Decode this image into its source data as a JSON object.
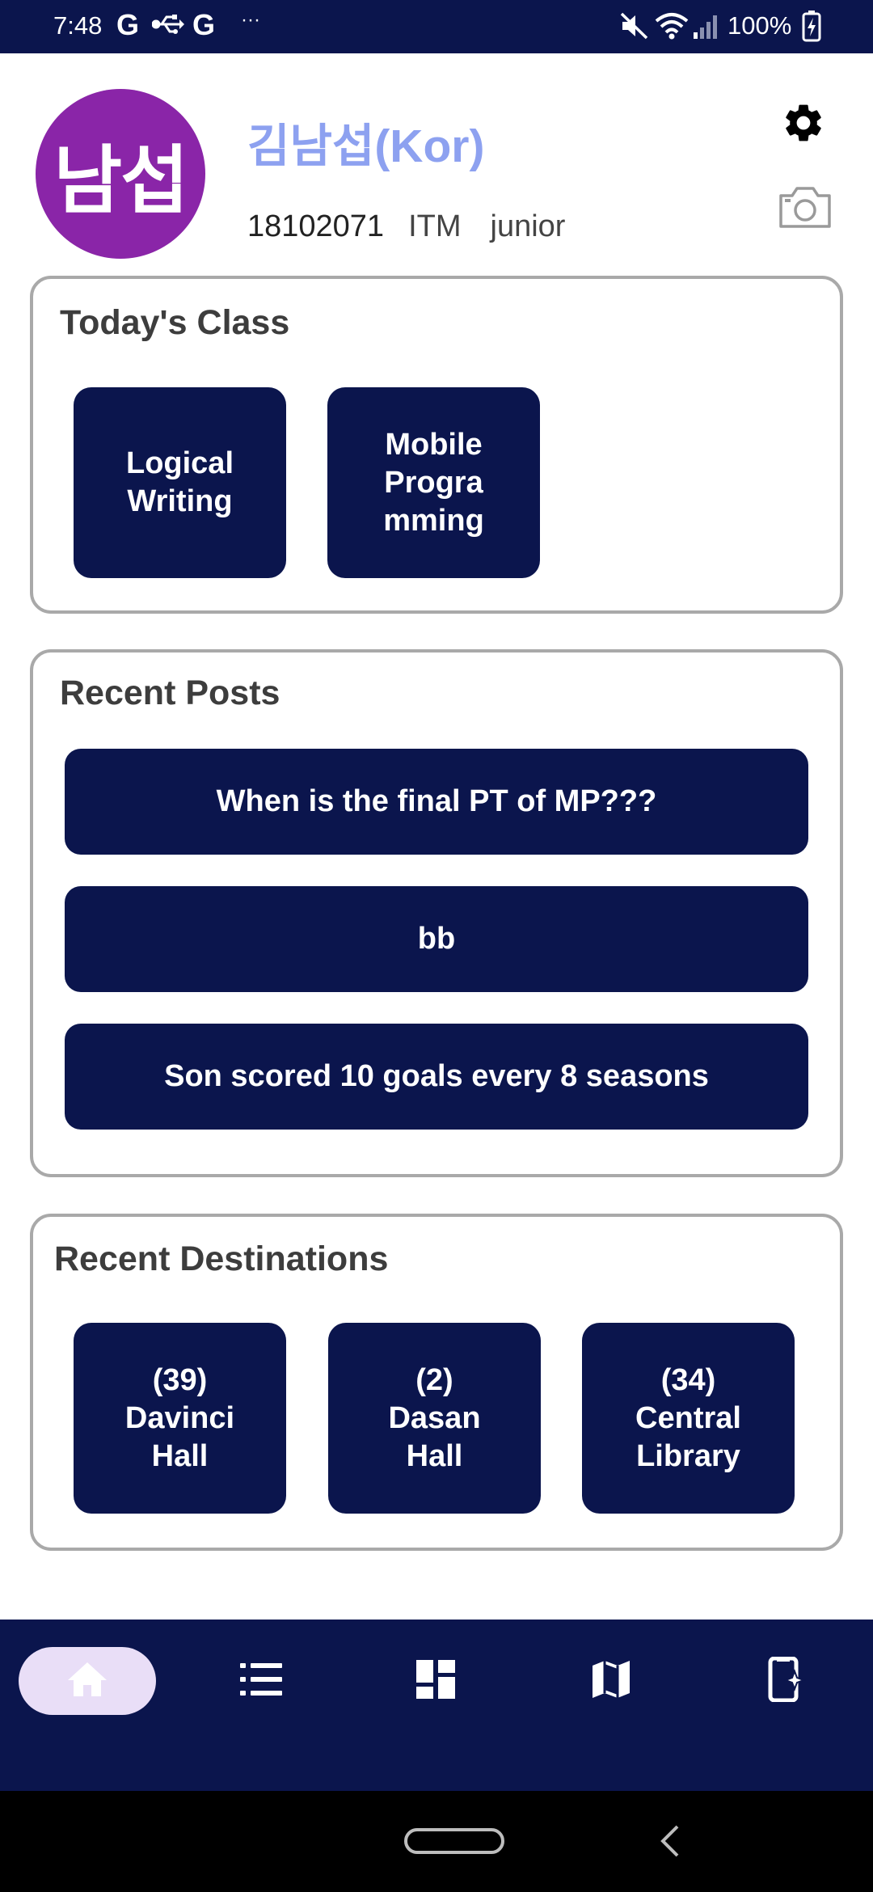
{
  "status_bar": {
    "time": "7:48",
    "g1": "G",
    "usb_icon": "usb-icon",
    "g2": "G",
    "dots": "···",
    "mute_icon": "mute-icon",
    "wifi_icon": "wifi-icon",
    "signal_icon": "signal-icon",
    "battery_text": "100%",
    "battery_icon": "battery-charging-icon"
  },
  "profile": {
    "avatar_text": "남섭",
    "avatar_color": "#8a25a8",
    "name": "김남섭(Kor)",
    "student_id": "18102071",
    "major": "ITM",
    "year": "junior",
    "settings_icon": "gear-icon",
    "camera_icon": "camera-icon"
  },
  "todays_class": {
    "title": "Today's Class",
    "classes": [
      {
        "label": "Logical\nWriting"
      },
      {
        "label": "Mobile\nProgra\nmming"
      }
    ]
  },
  "recent_posts": {
    "title": "Recent Posts",
    "posts": [
      {
        "label": "When is the final PT of MP???"
      },
      {
        "label": "bb"
      },
      {
        "label": "Son scored 10 goals every 8 seasons"
      }
    ]
  },
  "recent_destinations": {
    "title": "Recent Destinations",
    "destinations": [
      {
        "label": "(39)\nDavinci\nHall"
      },
      {
        "label": "(2)\nDasan\nHall"
      },
      {
        "label": "(34)\nCentral\nLibrary"
      }
    ]
  },
  "bottom_nav": {
    "items": [
      {
        "icon": "home-icon",
        "active": true
      },
      {
        "icon": "list-icon",
        "active": false
      },
      {
        "icon": "dashboard-icon",
        "active": false
      },
      {
        "icon": "map-icon",
        "active": false
      },
      {
        "icon": "phone-sparkle-icon",
        "active": false
      }
    ]
  },
  "colors": {
    "primary": "#0b154d",
    "name_accent": "#8da1f0",
    "home_pill": "#e9def7",
    "card_border": "#a9a9a9"
  }
}
